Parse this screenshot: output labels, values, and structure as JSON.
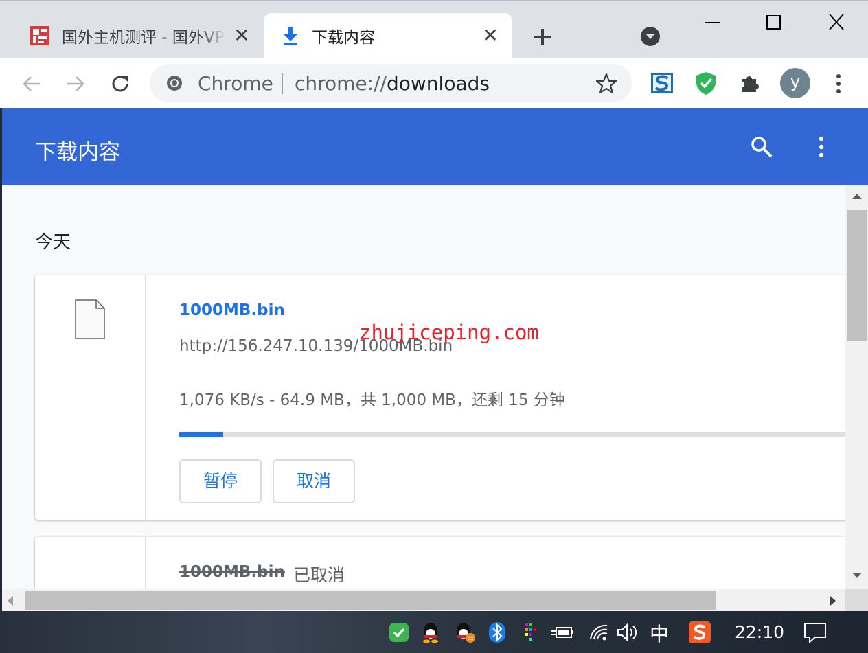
{
  "tabs": [
    {
      "title": "国外主机测评 - 国外VPS",
      "active": false
    },
    {
      "title": "下载内容",
      "active": true
    }
  ],
  "omnibox": {
    "site_label": "Chrome",
    "url_scheme": "chrome://",
    "url_path": "downloads"
  },
  "avatar_letter": "y",
  "page": {
    "title": "下载内容",
    "date_group": "今天"
  },
  "downloads": [
    {
      "file_name": "1000MB.bin",
      "url": "http://156.247.10.139/1000MB.bin",
      "status": "1,076 KB/s - 64.9 MB，共 1,000 MB，还剩 15 分钟",
      "progress": 0.065,
      "pause_label": "暂停",
      "cancel_label": "取消"
    },
    {
      "file_name": "1000MB.bin",
      "status": "已取消"
    }
  ],
  "watermark": "zhujiceping.com",
  "taskbar": {
    "ime": "中",
    "clock": "22:10"
  },
  "colors": {
    "header_blue": "#3367d6",
    "link_blue": "#1a73e8",
    "progress_blue": "#1a73e8"
  }
}
